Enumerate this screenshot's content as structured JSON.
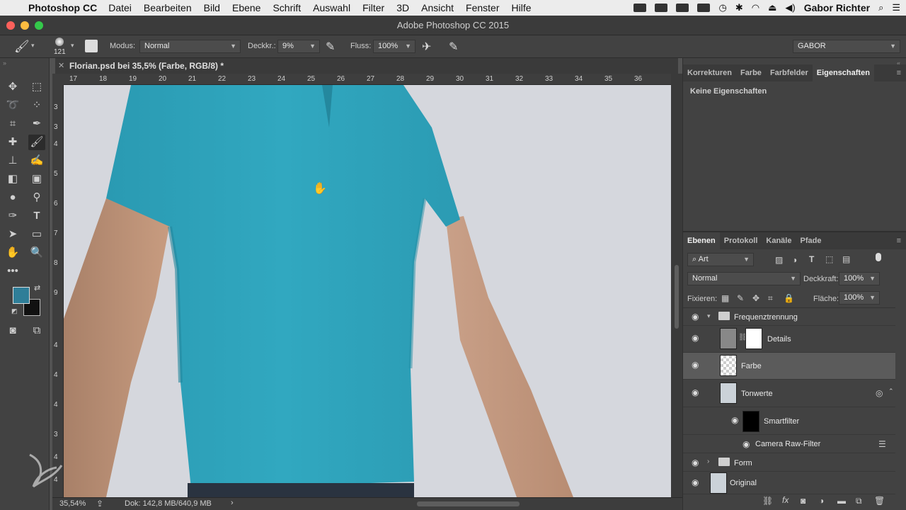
{
  "menubar": {
    "app_name": "Photoshop CC",
    "items": [
      "Datei",
      "Bearbeiten",
      "Bild",
      "Ebene",
      "Schrift",
      "Auswahl",
      "Filter",
      "3D",
      "Ansicht",
      "Fenster",
      "Hilfe"
    ],
    "user": "Gabor Richter"
  },
  "window": {
    "title": "Adobe Photoshop CC 2015"
  },
  "options": {
    "brush_size": "121",
    "mode_label": "Modus:",
    "mode_value": "Normal",
    "opacity_label": "Deckkr.:",
    "opacity_value": "9%",
    "flow_label": "Fluss:",
    "flow_value": "100%",
    "workspace": "GABOR"
  },
  "document": {
    "tab_title": "Florian.psd bei 35,5% (Farbe, RGB/8) *",
    "ruler_top": [
      "17",
      "18",
      "19",
      "20",
      "21",
      "22",
      "23",
      "24",
      "25",
      "26",
      "27",
      "28",
      "29",
      "30",
      "31",
      "32",
      "33",
      "34",
      "35",
      "36"
    ],
    "ruler_left": [
      "3",
      "3",
      "4",
      "5",
      "6",
      "7",
      "8",
      "9",
      "4",
      "4",
      "4",
      "3",
      "4",
      "4"
    ],
    "zoom": "35,54%",
    "doc_info": "Dok: 142,8 MB/640,9 MB"
  },
  "properties_panel": {
    "tabs": [
      "Korrekturen",
      "Farbe",
      "Farbfelder",
      "Eigenschaften"
    ],
    "active_tab": 3,
    "empty_text": "Keine Eigenschaften"
  },
  "layers_panel": {
    "tabs": [
      "Ebenen",
      "Protokoll",
      "Kanäle",
      "Pfade"
    ],
    "active_tab": 0,
    "filter_kind": "Art",
    "blend_mode": "Normal",
    "opacity_label": "Deckkraft:",
    "opacity_value": "100%",
    "lock_label": "Fixieren:",
    "fill_label": "Fläche:",
    "fill_value": "100%",
    "layers": [
      {
        "name": "Frequenztrennung",
        "type": "group"
      },
      {
        "name": "Details",
        "type": "layer"
      },
      {
        "name": "Farbe",
        "type": "layer",
        "selected": true
      },
      {
        "name": "Tonwerte",
        "type": "smart-object"
      },
      {
        "name": "Smartfilter",
        "type": "smart-filter"
      },
      {
        "name": "Camera Raw-Filter",
        "type": "filter"
      },
      {
        "name": "Form",
        "type": "group"
      },
      {
        "name": "Original",
        "type": "smart-object"
      }
    ]
  },
  "colors": {
    "foreground": "#2f7e98",
    "background": "#111111",
    "shirt": "#2fa6bd",
    "backdrop": "#d4d6dc"
  }
}
